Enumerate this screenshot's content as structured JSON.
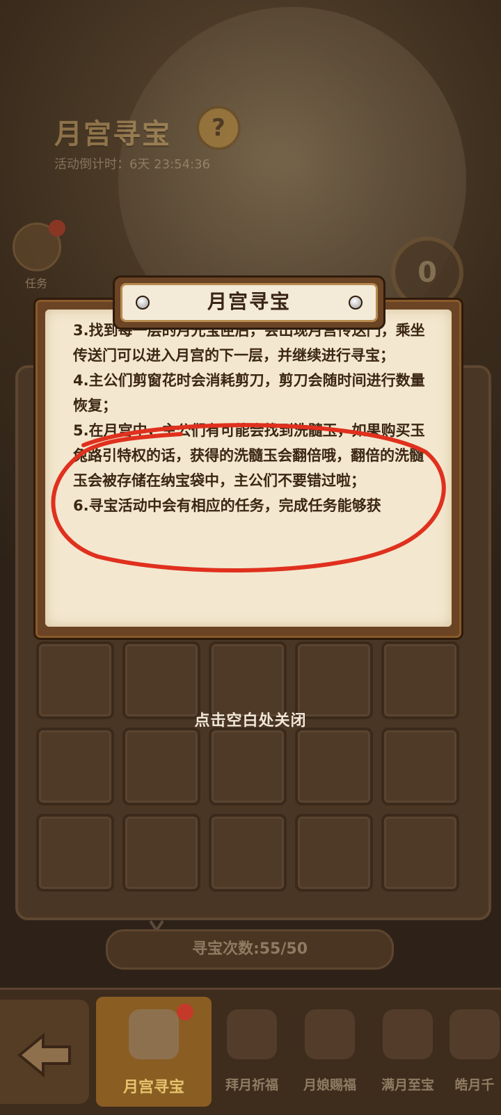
{
  "background": {
    "event_title": "月宫寻宝",
    "countdown": "活动倒计时：6天 23:54:36",
    "task_label": "任务",
    "counter_value": "0",
    "treasure_count": "寻宝次数:55/50"
  },
  "dialog": {
    "title": "月宫寻宝",
    "rules": [
      "3.找到每一层的月光宝匣后，会出现月宫传送门，乘坐传送门可以进入月宫的下一层，并继续进行寻宝；",
      "4.主公们剪窗花时会消耗剪刀，剪刀会随时间进行数量恢复；",
      "5.在月宫中，主公们有可能会找到洗髓玉，如果购买玉兔路引特权的话，获得的洗髓玉会翻倍哦，翻倍的洗髓玉会被存储在纳宝袋中，主公们不要错过啦；",
      "6.寻宝活动中会有相应的任务，完成任务能够获"
    ],
    "close_hint": "点击空白处关闭"
  },
  "bottom_nav": {
    "tabs": [
      {
        "label": "月宫寻宝",
        "active": true
      },
      {
        "label": "拜月祈福",
        "active": false
      },
      {
        "label": "月娘赐福",
        "active": false
      },
      {
        "label": "满月至宝",
        "active": false
      },
      {
        "label": "皓月千",
        "active": false
      }
    ]
  },
  "colors": {
    "annotation_circle": "#e0301e",
    "parchment": "#f3e7cf",
    "active_tab": "#8a5d22"
  },
  "icons": [
    "help-icon",
    "task-icon",
    "back-arrow-icon",
    "scissors-icon",
    "chest-icon"
  ]
}
